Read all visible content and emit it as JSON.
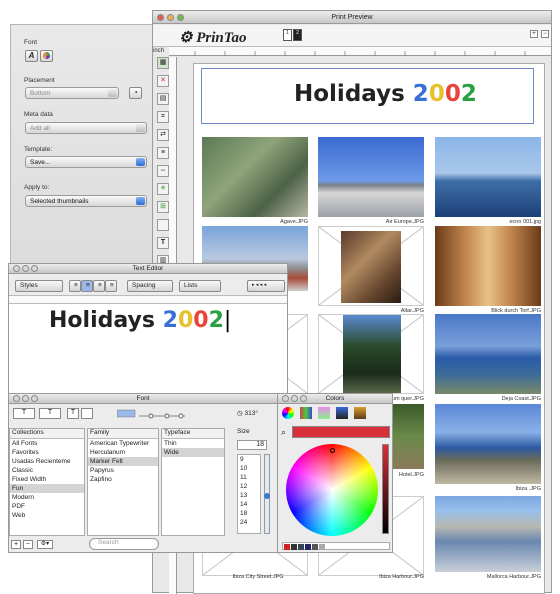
{
  "drawer": {
    "font_label": "Font",
    "placement_label": "Placement",
    "placement_value": "Bottom",
    "meta_label": "Meta data",
    "meta_value": "Add all",
    "template_label": "Template:",
    "template_value": "Save...",
    "apply_label": "Apply to:",
    "apply_value": "Selected thumbnails"
  },
  "preview": {
    "window_title": "Print Preview",
    "app_name": "PrinTao",
    "ruler_unit": "inch",
    "page_heading": {
      "word": "Holidays",
      "year_digits": [
        "2",
        "0",
        "0",
        "2"
      ]
    },
    "thumbnails": [
      {
        "caption": "Agave.JPG"
      },
      {
        "caption": "Air Europe.JPG"
      },
      {
        "caption": "ecnn 001.jpg"
      },
      {
        "caption": ""
      },
      {
        "caption": "Altar.JPG"
      },
      {
        "caption": "Blick durch Torf.JPG"
      },
      {
        "caption": ""
      },
      {
        "caption": "Baum quer.JPG"
      },
      {
        "caption": "Deja Coast.JPG"
      },
      {
        "caption": "Hotel.JPG"
      },
      {
        "caption": ""
      },
      {
        "caption": "Ibiza .JPG"
      },
      {
        "caption": "Ibiza City Street.JPG"
      },
      {
        "caption": "Ibiza Harbour.JPG"
      },
      {
        "caption": "Mallorca Harbour.JPG"
      }
    ]
  },
  "text_editor": {
    "title": "Text Editor",
    "styles_label": "Styles",
    "spacing_label": "Spacing",
    "lists_label": "Lists",
    "content": {
      "word": "Holidays",
      "year_digits": [
        "2",
        "0",
        "0",
        "2"
      ]
    }
  },
  "font_panel": {
    "title": "Font",
    "size_value": "18",
    "angle_label": "313°",
    "search_placeholder": "Search",
    "collections_header": "Collections",
    "family_header": "Family",
    "typeface_header": "Typeface",
    "size_header": "Size",
    "collections": [
      "All Fonts",
      "Favorites",
      "Usadas Recienteme",
      "Classic",
      "Fixed Width",
      "Fun",
      "Modern",
      "PDF",
      "Web"
    ],
    "collections_selected": "Fun",
    "families": [
      "American Typewriter",
      "Herculanum",
      "Marker Felt",
      "Papyrus",
      "Zapfino"
    ],
    "family_selected": "Marker Felt",
    "typefaces": [
      "Thin",
      "Wide"
    ],
    "typeface_selected": "Wide",
    "sizes": [
      "9",
      "10",
      "11",
      "12",
      "13",
      "14",
      "18",
      "24"
    ]
  },
  "colors_panel": {
    "title": "Colors",
    "swatch_color": "#d8303a"
  }
}
